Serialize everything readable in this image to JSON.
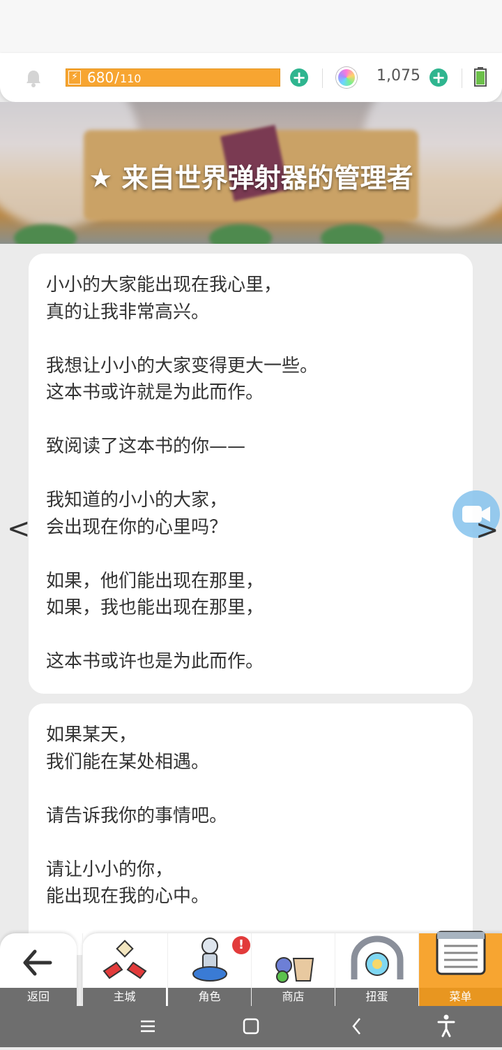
{
  "top_bar": {
    "energy_current": "680",
    "energy_separator": "/",
    "energy_max": "110",
    "gem_count": "1,075"
  },
  "banner": {
    "title": "★ 来自世界弹射器的管理者"
  },
  "card1": {
    "paragraphs": [
      "小小的大家能出现在我心里，\n真的让我非常高兴。",
      "我想让小小的大家变得更大一些。\n这本书或许就是为此而作。",
      "致阅读了这本书的你——",
      "我知道的小小的大家，\n会出现在你的心里吗？",
      "如果，他们能出现在那里，\n如果，我也能出现在那里，",
      "这本书或许也是为此而作。"
    ]
  },
  "card2": {
    "paragraphs": [
      "如果某天，\n我们能在某处相遇。",
      "请告诉我你的事情吧。",
      "请让小小的你，\n能出现在我的心中。"
    ]
  },
  "nav": {
    "prev": "<",
    "next": ">"
  },
  "tabbar": {
    "back_label": "返回",
    "tabs": [
      {
        "label": "主城",
        "icon": "home-icon"
      },
      {
        "label": "角色",
        "icon": "character-icon",
        "badge": "!"
      },
      {
        "label": "商店",
        "icon": "shop-icon"
      },
      {
        "label": "扭蛋",
        "icon": "gacha-icon"
      },
      {
        "label": "菜单",
        "icon": "menu-icon",
        "active": true
      }
    ]
  },
  "colors": {
    "energy": "#f7a531",
    "plus": "#2fb58f",
    "active_tab": "#f7a531",
    "badge": "#e23b3b"
  }
}
